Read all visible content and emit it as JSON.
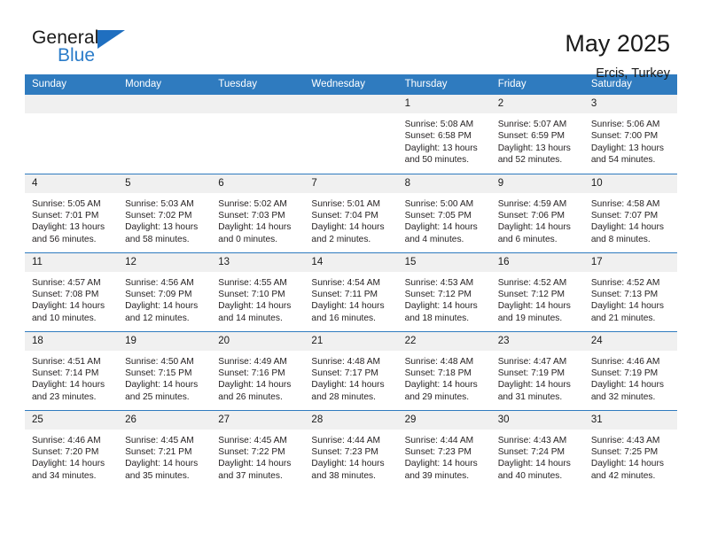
{
  "brand": {
    "line1": "General",
    "line2": "Blue",
    "triangle_icon": "blue-triangle-icon",
    "accent_color": "#2b7cc9"
  },
  "header": {
    "title": "May 2025",
    "location": "Ercis, Turkey"
  },
  "theme": {
    "header_bg": "#2f7bbf",
    "header_text": "#ffffff",
    "daynum_bg": "#f0f0f0",
    "row_rule": "#2f7bbf",
    "body_text": "#231f20"
  },
  "calendar": {
    "weekday_headers": [
      "Sunday",
      "Monday",
      "Tuesday",
      "Wednesday",
      "Thursday",
      "Friday",
      "Saturday"
    ],
    "weeks": [
      [
        {
          "day": "",
          "empty": true,
          "lines": []
        },
        {
          "day": "",
          "empty": true,
          "lines": []
        },
        {
          "day": "",
          "empty": true,
          "lines": []
        },
        {
          "day": "",
          "empty": true,
          "lines": []
        },
        {
          "day": "1",
          "empty": false,
          "lines": [
            "Sunrise: 5:08 AM",
            "Sunset: 6:58 PM",
            "Daylight: 13 hours",
            "and 50 minutes."
          ]
        },
        {
          "day": "2",
          "empty": false,
          "lines": [
            "Sunrise: 5:07 AM",
            "Sunset: 6:59 PM",
            "Daylight: 13 hours",
            "and 52 minutes."
          ]
        },
        {
          "day": "3",
          "empty": false,
          "lines": [
            "Sunrise: 5:06 AM",
            "Sunset: 7:00 PM",
            "Daylight: 13 hours",
            "and 54 minutes."
          ]
        }
      ],
      [
        {
          "day": "4",
          "empty": false,
          "lines": [
            "Sunrise: 5:05 AM",
            "Sunset: 7:01 PM",
            "Daylight: 13 hours",
            "and 56 minutes."
          ]
        },
        {
          "day": "5",
          "empty": false,
          "lines": [
            "Sunrise: 5:03 AM",
            "Sunset: 7:02 PM",
            "Daylight: 13 hours",
            "and 58 minutes."
          ]
        },
        {
          "day": "6",
          "empty": false,
          "lines": [
            "Sunrise: 5:02 AM",
            "Sunset: 7:03 PM",
            "Daylight: 14 hours",
            "and 0 minutes."
          ]
        },
        {
          "day": "7",
          "empty": false,
          "lines": [
            "Sunrise: 5:01 AM",
            "Sunset: 7:04 PM",
            "Daylight: 14 hours",
            "and 2 minutes."
          ]
        },
        {
          "day": "8",
          "empty": false,
          "lines": [
            "Sunrise: 5:00 AM",
            "Sunset: 7:05 PM",
            "Daylight: 14 hours",
            "and 4 minutes."
          ]
        },
        {
          "day": "9",
          "empty": false,
          "lines": [
            "Sunrise: 4:59 AM",
            "Sunset: 7:06 PM",
            "Daylight: 14 hours",
            "and 6 minutes."
          ]
        },
        {
          "day": "10",
          "empty": false,
          "lines": [
            "Sunrise: 4:58 AM",
            "Sunset: 7:07 PM",
            "Daylight: 14 hours",
            "and 8 minutes."
          ]
        }
      ],
      [
        {
          "day": "11",
          "empty": false,
          "lines": [
            "Sunrise: 4:57 AM",
            "Sunset: 7:08 PM",
            "Daylight: 14 hours",
            "and 10 minutes."
          ]
        },
        {
          "day": "12",
          "empty": false,
          "lines": [
            "Sunrise: 4:56 AM",
            "Sunset: 7:09 PM",
            "Daylight: 14 hours",
            "and 12 minutes."
          ]
        },
        {
          "day": "13",
          "empty": false,
          "lines": [
            "Sunrise: 4:55 AM",
            "Sunset: 7:10 PM",
            "Daylight: 14 hours",
            "and 14 minutes."
          ]
        },
        {
          "day": "14",
          "empty": false,
          "lines": [
            "Sunrise: 4:54 AM",
            "Sunset: 7:11 PM",
            "Daylight: 14 hours",
            "and 16 minutes."
          ]
        },
        {
          "day": "15",
          "empty": false,
          "lines": [
            "Sunrise: 4:53 AM",
            "Sunset: 7:12 PM",
            "Daylight: 14 hours",
            "and 18 minutes."
          ]
        },
        {
          "day": "16",
          "empty": false,
          "lines": [
            "Sunrise: 4:52 AM",
            "Sunset: 7:12 PM",
            "Daylight: 14 hours",
            "and 19 minutes."
          ]
        },
        {
          "day": "17",
          "empty": false,
          "lines": [
            "Sunrise: 4:52 AM",
            "Sunset: 7:13 PM",
            "Daylight: 14 hours",
            "and 21 minutes."
          ]
        }
      ],
      [
        {
          "day": "18",
          "empty": false,
          "lines": [
            "Sunrise: 4:51 AM",
            "Sunset: 7:14 PM",
            "Daylight: 14 hours",
            "and 23 minutes."
          ]
        },
        {
          "day": "19",
          "empty": false,
          "lines": [
            "Sunrise: 4:50 AM",
            "Sunset: 7:15 PM",
            "Daylight: 14 hours",
            "and 25 minutes."
          ]
        },
        {
          "day": "20",
          "empty": false,
          "lines": [
            "Sunrise: 4:49 AM",
            "Sunset: 7:16 PM",
            "Daylight: 14 hours",
            "and 26 minutes."
          ]
        },
        {
          "day": "21",
          "empty": false,
          "lines": [
            "Sunrise: 4:48 AM",
            "Sunset: 7:17 PM",
            "Daylight: 14 hours",
            "and 28 minutes."
          ]
        },
        {
          "day": "22",
          "empty": false,
          "lines": [
            "Sunrise: 4:48 AM",
            "Sunset: 7:18 PM",
            "Daylight: 14 hours",
            "and 29 minutes."
          ]
        },
        {
          "day": "23",
          "empty": false,
          "lines": [
            "Sunrise: 4:47 AM",
            "Sunset: 7:19 PM",
            "Daylight: 14 hours",
            "and 31 minutes."
          ]
        },
        {
          "day": "24",
          "empty": false,
          "lines": [
            "Sunrise: 4:46 AM",
            "Sunset: 7:19 PM",
            "Daylight: 14 hours",
            "and 32 minutes."
          ]
        }
      ],
      [
        {
          "day": "25",
          "empty": false,
          "lines": [
            "Sunrise: 4:46 AM",
            "Sunset: 7:20 PM",
            "Daylight: 14 hours",
            "and 34 minutes."
          ]
        },
        {
          "day": "26",
          "empty": false,
          "lines": [
            "Sunrise: 4:45 AM",
            "Sunset: 7:21 PM",
            "Daylight: 14 hours",
            "and 35 minutes."
          ]
        },
        {
          "day": "27",
          "empty": false,
          "lines": [
            "Sunrise: 4:45 AM",
            "Sunset: 7:22 PM",
            "Daylight: 14 hours",
            "and 37 minutes."
          ]
        },
        {
          "day": "28",
          "empty": false,
          "lines": [
            "Sunrise: 4:44 AM",
            "Sunset: 7:23 PM",
            "Daylight: 14 hours",
            "and 38 minutes."
          ]
        },
        {
          "day": "29",
          "empty": false,
          "lines": [
            "Sunrise: 4:44 AM",
            "Sunset: 7:23 PM",
            "Daylight: 14 hours",
            "and 39 minutes."
          ]
        },
        {
          "day": "30",
          "empty": false,
          "lines": [
            "Sunrise: 4:43 AM",
            "Sunset: 7:24 PM",
            "Daylight: 14 hours",
            "and 40 minutes."
          ]
        },
        {
          "day": "31",
          "empty": false,
          "lines": [
            "Sunrise: 4:43 AM",
            "Sunset: 7:25 PM",
            "Daylight: 14 hours",
            "and 42 minutes."
          ]
        }
      ]
    ]
  }
}
